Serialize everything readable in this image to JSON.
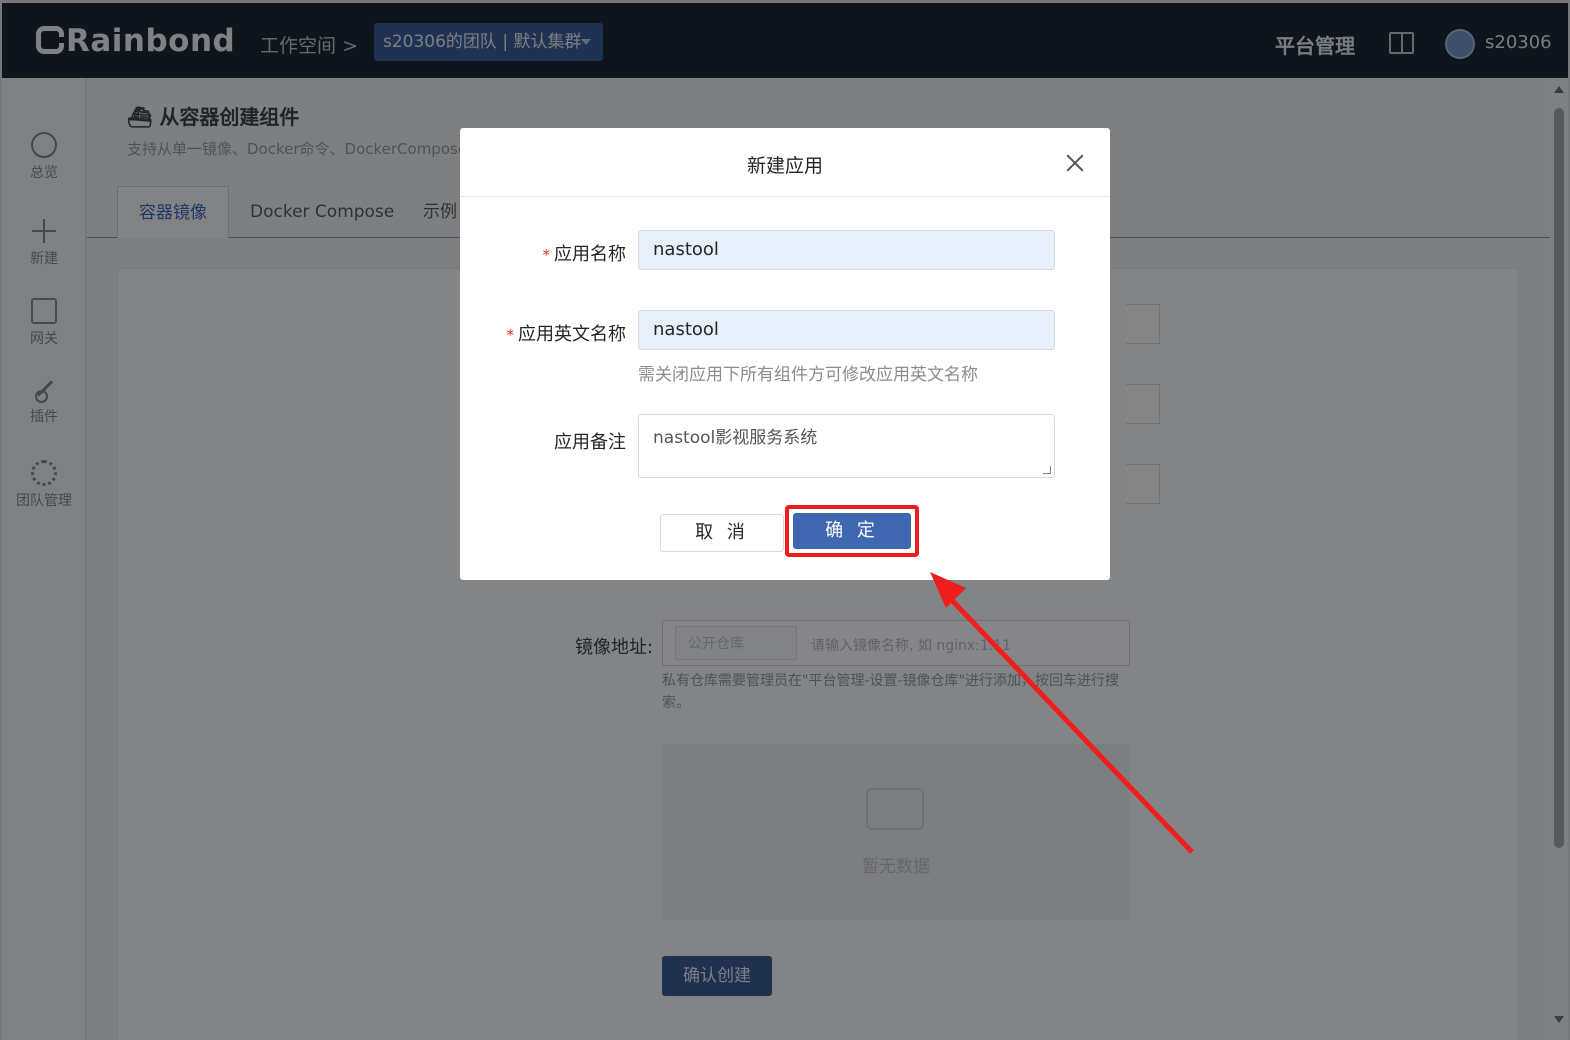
{
  "topbar": {
    "logo": "Rainbond",
    "breadcrumb": "工作空间",
    "breadcrumb_sep": ">",
    "team_selector": "s20306的团队 | 默认集群",
    "platform_manage": "平台管理",
    "username": "s20306"
  },
  "sidebar": {
    "items": [
      {
        "label": "总览",
        "icon": "dashboard-icon"
      },
      {
        "label": "新建",
        "icon": "plus-icon"
      },
      {
        "label": "网关",
        "icon": "gateway-icon"
      },
      {
        "label": "插件",
        "icon": "plugin-icon"
      },
      {
        "label": "团队管理",
        "icon": "gear-icon"
      }
    ]
  },
  "page": {
    "title": "从容器创建组件",
    "description": "支持从单一镜像、Docker命令、DockerCompose",
    "tabs": [
      "容器镜像",
      "Docker Compose",
      "示例"
    ],
    "image_label": "镜像地址:",
    "image_prefix": "公开仓库",
    "image_placeholder": "请输入镜像名称, 如 nginx:1.11",
    "image_help": "私有仓库需要管理员在\"平台管理-设置-镜像仓库\"进行添加，按回车进行搜索。",
    "empty_text": "暂无数据",
    "confirm_create": "确认创建"
  },
  "modal": {
    "title": "新建应用",
    "required_mark": "*",
    "app_name_label": "应用名称",
    "app_name_value": "nastool",
    "app_en_name_label": "应用英文名称",
    "app_en_name_value": "nastool",
    "app_en_name_help": "需关闭应用下所有组件方可修改应用英文名称",
    "app_note_label": "应用备注",
    "app_note_value": "nastool影视服务系统",
    "cancel_label": "取 消",
    "ok_label": "确 定"
  },
  "colors": {
    "accent": "#4068b0",
    "highlight": "#f01d1d",
    "topbar": "#1d2736"
  }
}
